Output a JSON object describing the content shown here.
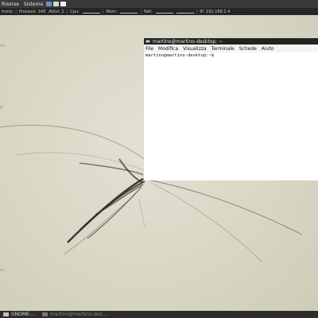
{
  "topbar": {
    "menu_resources": "Risorse",
    "menu_system": "Sistema"
  },
  "statusbar": {
    "tronic": "tronic",
    "processes": "Processi: 148",
    "active": "Attivi: 1",
    "cpu": "Cpu:",
    "mem": "Mem:",
    "net": "Net:",
    "ip": "IP: 192.168.1.4"
  },
  "conky": {
    "line1": "ts",
    "line2": "0",
    "line3": "ur,"
  },
  "terminal": {
    "title": "martino@martino-desktop: ~",
    "menus": [
      "File",
      "Modifica",
      "Visualizza",
      "Terminale",
      "Schede",
      "Aiuto"
    ],
    "prompt": "martino@martino-desktop:~$"
  },
  "taskbar": {
    "gnome_label": "GNOME-...",
    "terminal_label": "martino@martino-des..."
  }
}
